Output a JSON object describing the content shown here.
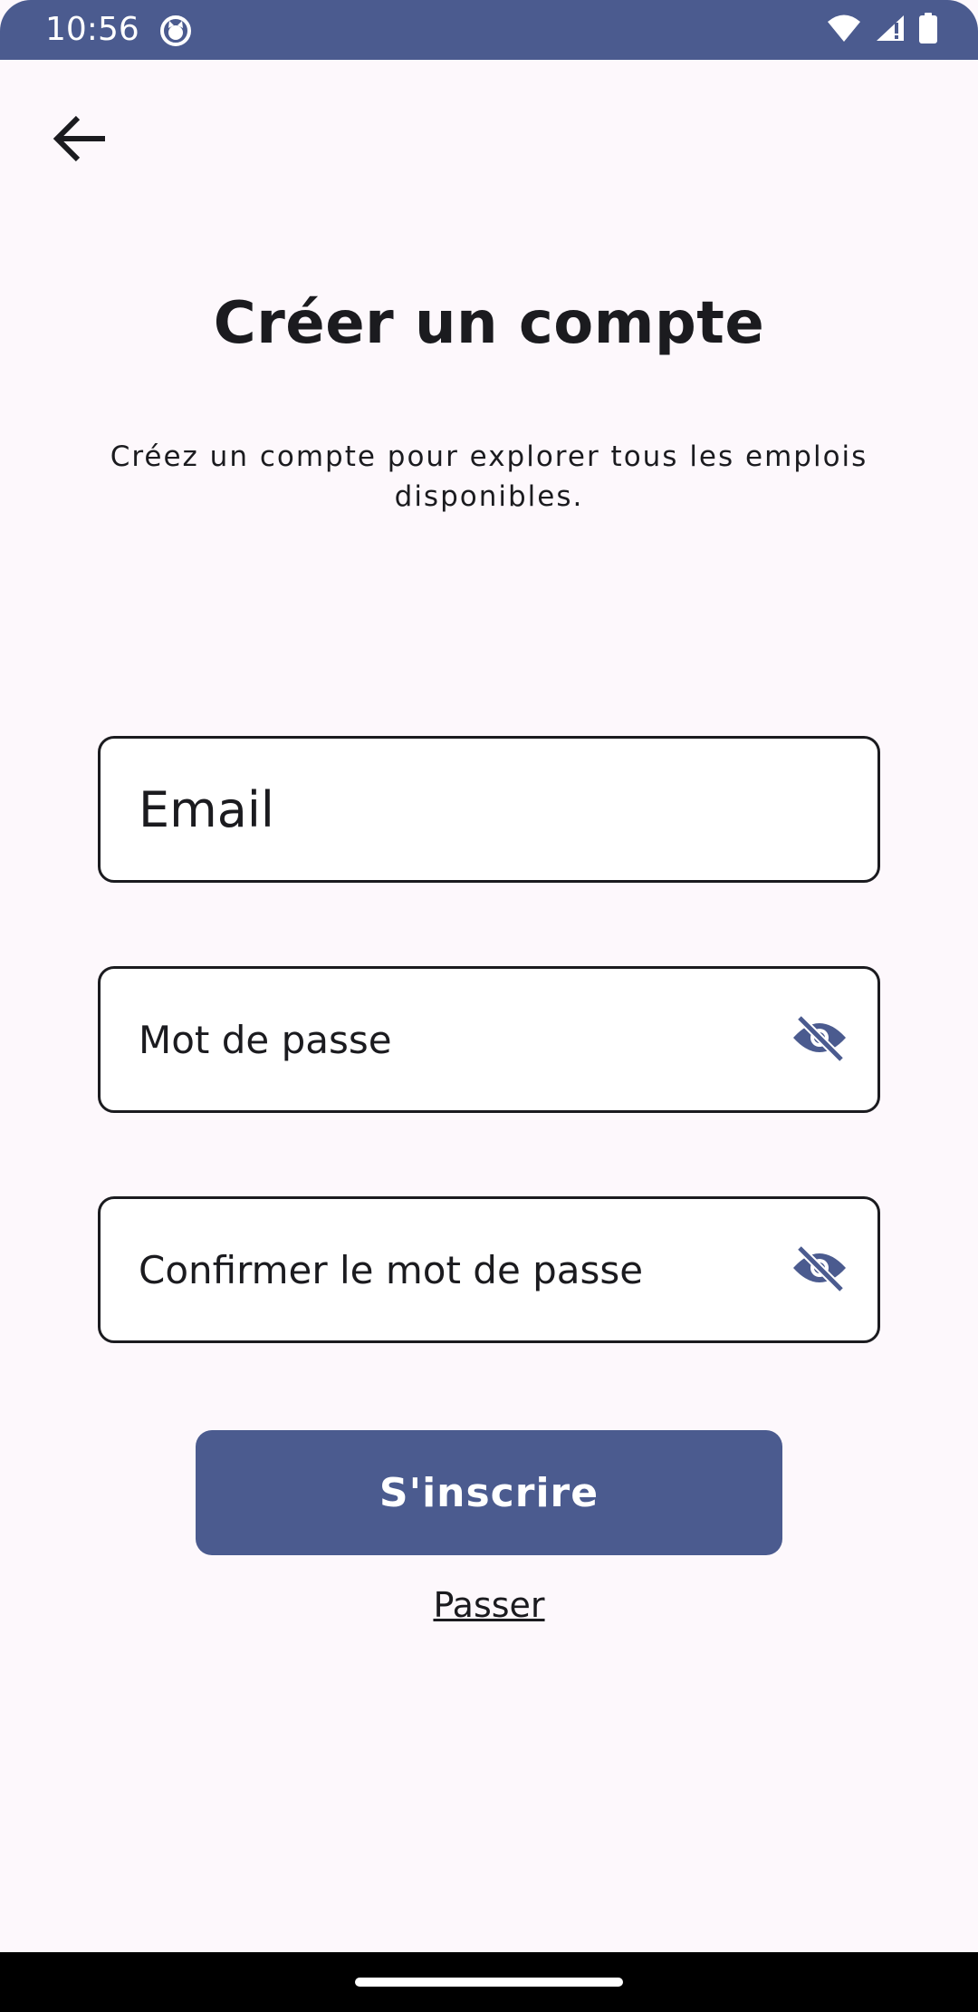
{
  "status_bar": {
    "time": "10:56",
    "icons": [
      "cat-icon",
      "wifi-icon",
      "signal-icon",
      "battery-icon"
    ]
  },
  "header": {
    "back_icon": "arrow-left-icon"
  },
  "main": {
    "title": "Créer un compte",
    "subtitle": "Créez un compte pour explorer tous les emplois disponibles."
  },
  "form": {
    "email_placeholder": "Email",
    "password_placeholder": "Mot de passe",
    "confirm_placeholder": "Confirmer le mot de passe",
    "visibility_icon": "eye-off-icon",
    "submit_label": "S'inscrire",
    "skip_label": "Passer"
  },
  "colors": {
    "accent": "#4b5b8f",
    "background": "#fdf8fc",
    "text": "#1b1b1f"
  }
}
